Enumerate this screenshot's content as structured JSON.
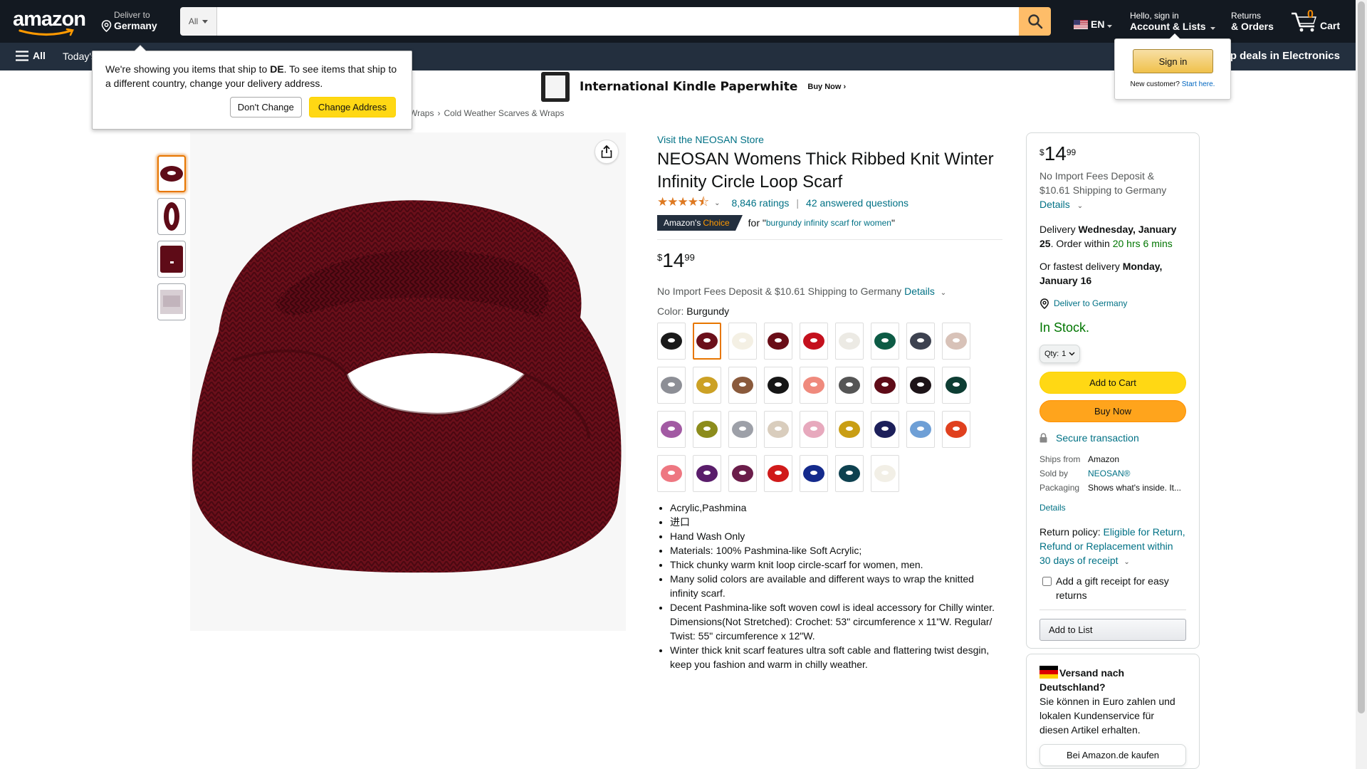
{
  "nav": {
    "logo": "amazon",
    "deliver_line1": "Deliver to",
    "deliver_line2": "Germany",
    "search_category": "All",
    "search_value": "",
    "lang": "EN",
    "account_line1": "Hello, sign in",
    "account_line2": "Account & Lists",
    "returns_line1": "Returns",
    "returns_line2": "& Orders",
    "cart_count": "0",
    "cart_label": "Cart"
  },
  "subnav": {
    "all": "All",
    "todays": "Today's",
    "promo": "op deals in Electronics"
  },
  "banner": {
    "title": "International Kindle Paperwhite",
    "cta": "Buy Now ›"
  },
  "breadcrumb": [
    "Wraps",
    "Cold Weather Scarves & Wraps"
  ],
  "delivery_popover": {
    "text_pre": "We're showing you items that ship to ",
    "country": "DE",
    "text_post": ". To see items that ship to a different country, change your delivery address.",
    "dont_change": "Don't Change",
    "change_address": "Change Address"
  },
  "signin_popover": {
    "button": "Sign in",
    "new_customer": "New customer?",
    "start_here": "Start here."
  },
  "product": {
    "store_link": "Visit the NEOSAN Store",
    "title": "NEOSAN Womens Thick Ribbed Knit Winter Infinity Circle Loop Scarf",
    "stars": "★★★★⯪",
    "rating_value": 4.5,
    "ratings": "8,846 ratings",
    "questions": "42 answered questions",
    "choice_label_1": "Amazon's",
    "choice_label_2": "Choice",
    "choice_for": "for \"",
    "choice_keyword": "burgundy infinity scarf for women",
    "choice_end": "\"",
    "price_symbol": "$",
    "price_whole": "14",
    "price_fraction": "99",
    "import_fees": "No Import Fees Deposit & $10.61 Shipping to Germany",
    "details": "Details",
    "color_label": "Color:",
    "color_value": "Burgundy",
    "swatch_colors": [
      "#1a1a1a",
      "#6b0f1a",
      "#f4f0e4",
      "#6a0d17",
      "#c4101d",
      "#eceae4",
      "#0d5b45",
      "#3d4250",
      "#d8c2b8",
      "#8d8f96",
      "#cca125",
      "#8a5a3c",
      "#161616",
      "#ef8a7d",
      "#555555",
      "#5e0b17",
      "#1d1418",
      "#0d3d33",
      "#a25aa3",
      "#8c8c1c",
      "#9da0a8",
      "#d9cdbd",
      "#e7a9bd",
      "#c99e14",
      "#1c1f5a",
      "#6e9fd6",
      "#e0401e",
      "#ee7781",
      "#5a1d6b",
      "#6b1d4a",
      "#d01a1a",
      "#142a8c",
      "#0e4150",
      "#f2efe6"
    ],
    "selected_swatch": 1,
    "bullets": [
      "Acrylic,Pashmina",
      "进口",
      "Hand Wash Only",
      "Materials: 100% Pashmina-like Soft Acrylic;",
      "Thick chunky warm knit loop circle-scarf for women, men.",
      "Many solid colors are available and different ways to wrap the knitted infinity scarf.",
      "Decent Pashmina-like soft woven cowl is ideal accessory for Chilly winter. Dimensions(Not Stretched): Crochet: 53\" circumference x 11\"W. Regular/ Twist: 55\" circumference x 12\"W.",
      "Winter thick knit scarf features ultra soft cable and flattering twist desgin, keep you fashion and warm in chilly weather."
    ]
  },
  "buybox": {
    "price_symbol": "$",
    "price_whole": "14",
    "price_fraction": "99",
    "fees": "No Import Fees Deposit & $10.61 Shipping to Germany",
    "details": "Details",
    "delivery_pre": "Delivery ",
    "delivery_date": "Wednesday, January 25",
    "delivery_mid": ". Order within ",
    "delivery_time": "20 hrs 6 mins",
    "fastest_pre": "Or fastest delivery ",
    "fastest_date": "Monday, January 16",
    "deliver_to": "Deliver to Germany",
    "stock": "In Stock.",
    "qty_label": "Qty:",
    "qty_value": "1",
    "add_to_cart": "Add to Cart",
    "buy_now": "Buy Now",
    "secure": "Secure transaction",
    "ships_from_k": "Ships from",
    "ships_from_v": "Amazon",
    "sold_by_k": "Sold by",
    "sold_by_v": "NEOSAN®",
    "packaging_k": "Packaging",
    "packaging_v": "Shows what's inside. It...",
    "details2": "Details",
    "return_pre": "Return policy: ",
    "return_link": "Eligible for Return, Refund or Replacement within 30 days of receipt",
    "gift": "Add a gift receipt for easy returns",
    "add_to_list": "Add to List"
  },
  "de_box": {
    "title": "Versand nach Deutschland?",
    "text": "Sie können in Euro zahlen und lokalen Kundenservice für diesen Artikel erhalten.",
    "button": "Bei Amazon.de kaufen"
  }
}
